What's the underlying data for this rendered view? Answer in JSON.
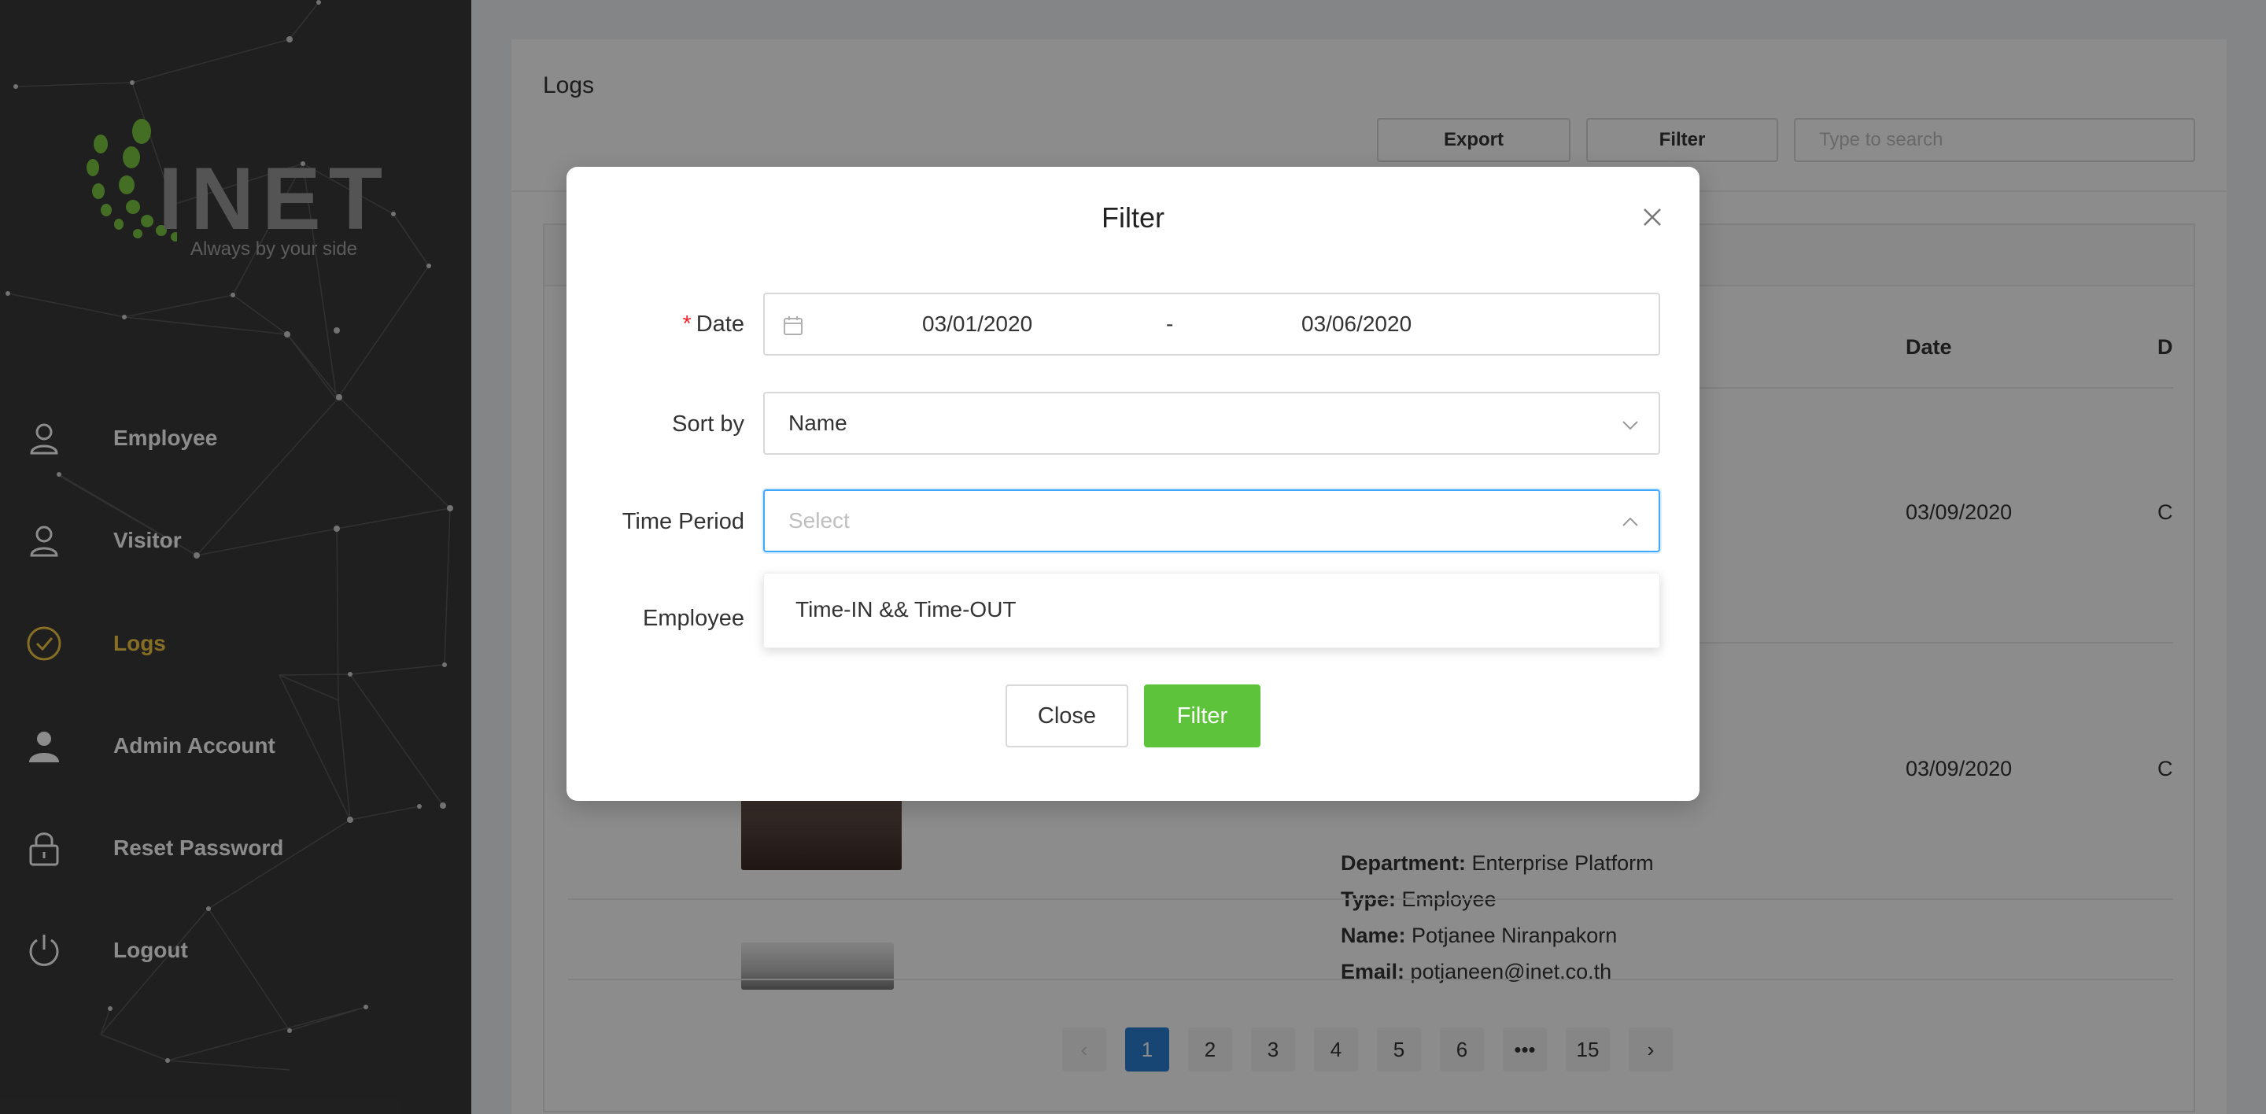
{
  "sidebar": {
    "logo_text": "INET",
    "logo_tagline": "Always by your side",
    "items": [
      {
        "label": "Employee",
        "icon": "user-outline-icon"
      },
      {
        "label": "Visitor",
        "icon": "user-outline-icon"
      },
      {
        "label": "Logs",
        "icon": "check-circle-icon",
        "active": true
      },
      {
        "label": "Admin Account",
        "icon": "user-filled-icon"
      },
      {
        "label": "Reset Password",
        "icon": "lock-icon"
      },
      {
        "label": "Logout",
        "icon": "power-icon"
      }
    ],
    "active_color": "#f5c842",
    "background": "#3a3a3a"
  },
  "page": {
    "title": "Logs",
    "export_label": "Export",
    "filter_label": "Filter",
    "search_placeholder": "Type to search",
    "columns": {
      "date": "Date",
      "d": "D"
    },
    "rows": [
      {
        "date": "03/09/2020",
        "d": "C"
      },
      {
        "date": "03/09/2020",
        "d": "C",
        "department_label": "Department:",
        "department": "Enterprise Platform",
        "type_label": "Type:",
        "type": "Employee"
      },
      {
        "name_label": "Name:",
        "name": "Potjanee Niranpakorn",
        "email_label": "Email:",
        "email": "potjaneen@inet.co.th"
      }
    ],
    "pagination": [
      "1",
      "2",
      "3",
      "4",
      "5",
      "6",
      "•••",
      "15"
    ],
    "current_page": "1",
    "prev_symbol": "‹",
    "next_symbol": "›"
  },
  "modal": {
    "title": "Filter",
    "date_label": "Date",
    "required_mark": "*",
    "date_start": "03/01/2020",
    "date_separator": "-",
    "date_end": "03/06/2020",
    "sort_label": "Sort by",
    "sort_value": "Name",
    "time_period_label": "Time Period",
    "time_period_placeholder": "Select",
    "time_period_options": [
      "Time-IN && Time-OUT"
    ],
    "employee_label": "Employee",
    "close_label": "Close",
    "filter_label": "Filter",
    "accent_green": "#5cc33a",
    "focus_blue": "#40a9ff"
  }
}
